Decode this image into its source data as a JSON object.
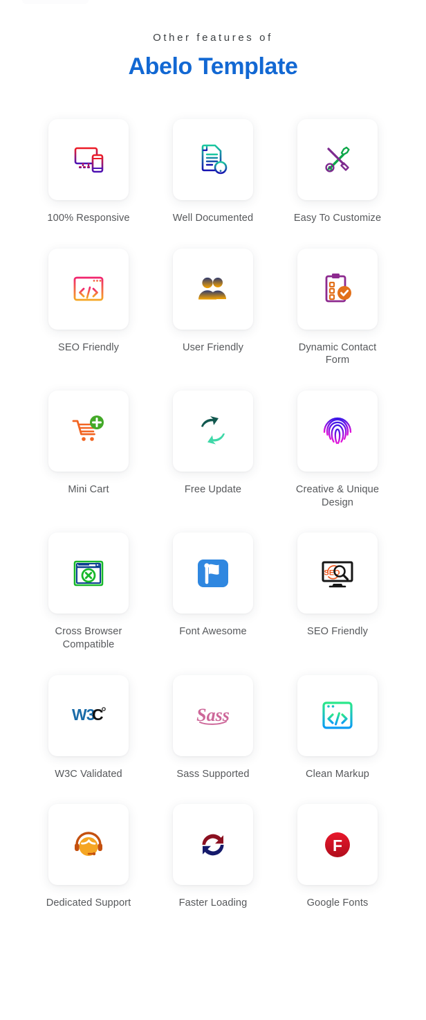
{
  "heading": {
    "eyebrow": "Other features of",
    "title": "Abelo Template",
    "title_color": "#1268d3",
    "eyebrow_color": "#3c4043"
  },
  "palette": {
    "page_background": "#ffffff",
    "card_background": "#ffffff",
    "label_color": "#56585b"
  },
  "features": [
    {
      "label": "100% Responsive",
      "icon": "responsive-devices-icon",
      "colors": [
        "#ee1c25",
        "#4b12b5"
      ]
    },
    {
      "label": "Well Documented",
      "icon": "document-alert-icon",
      "colors": [
        "#1bc9a0",
        "#1410b0"
      ]
    },
    {
      "label": "Easy To Customize",
      "icon": "wrench-screwdriver-icon",
      "colors": [
        "#7d2a8e",
        "#0ea74a"
      ]
    },
    {
      "label": "SEO Friendly",
      "icon": "browser-code-icon",
      "colors": [
        "#f0246e",
        "#f5a623"
      ]
    },
    {
      "label": "User Friendly",
      "icon": "two-users-icon",
      "colors": [
        "#2f3a6e",
        "#f5a300"
      ]
    },
    {
      "label": "Dynamic Contact Form",
      "icon": "clipboard-check-icon",
      "colors": [
        "#8d2a8f",
        "#e2701a"
      ]
    },
    {
      "label": "Mini Cart",
      "icon": "shopping-cart-plus-icon",
      "colors": [
        "#f26522",
        "#43a928"
      ]
    },
    {
      "label": "Free Update",
      "icon": "sync-arrows-icon",
      "colors": [
        "#12584f",
        "#3fd8a8"
      ]
    },
    {
      "label": "Creative & Unique Design",
      "icon": "fingerprint-icon",
      "colors": [
        "#3b16e8",
        "#e713d8"
      ]
    },
    {
      "label": "Cross Browser Compatible",
      "icon": "browser-error-icon",
      "colors": [
        "#0a3d8f",
        "#17b82a"
      ]
    },
    {
      "label": "Font Awesome",
      "icon": "flag-icon",
      "colors": [
        "#2f87e0",
        "#2f87e0"
      ]
    },
    {
      "label": "SEO Friendly",
      "icon": "monitor-seo-search-icon",
      "colors": [
        "#161616",
        "#ef5a22"
      ]
    },
    {
      "label": "W3C Validated",
      "icon": "w3c-logo-icon",
      "colors": [
        "#1a6ba8",
        "#111111"
      ]
    },
    {
      "label": "Sass Supported",
      "icon": "sass-logo-icon",
      "colors": [
        "#cd6799",
        "#cd6799"
      ]
    },
    {
      "label": "Clean Markup",
      "icon": "code-window-icon",
      "colors": [
        "#2ae88a",
        "#0a9bf5"
      ]
    },
    {
      "label": "Dedicated Support",
      "icon": "headset-support-icon",
      "colors": [
        "#c4500f",
        "#f5a623"
      ]
    },
    {
      "label": "Faster Loading",
      "icon": "refresh-circle-icon",
      "colors": [
        "#8b1020",
        "#151a6b"
      ]
    },
    {
      "label": "Google Fonts",
      "icon": "google-fonts-f-icon",
      "colors": [
        "#e8172b",
        "#b00d1c"
      ]
    }
  ]
}
